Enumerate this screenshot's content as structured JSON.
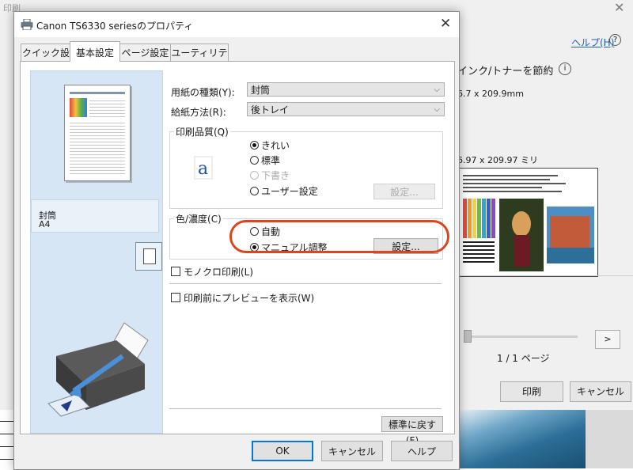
{
  "background_window": {
    "title": "印刷",
    "help_link": "ヘルプ(H)",
    "save_ink_toner": "インク/トナーを節約",
    "paper_size_mm": "6.7 x 209.9mm",
    "paper_size_mm2": "6.97 x 209.97 ミリ",
    "page_indicator": "1 / 1 ページ",
    "next_button": ">",
    "print_button": "印刷",
    "cancel_button": "キャンセル"
  },
  "dialog": {
    "title": "Canon TS6330 seriesのプロパティ",
    "tabs": [
      {
        "label": "クイック設定"
      },
      {
        "label": "基本設定"
      },
      {
        "label": "ページ設定"
      },
      {
        "label": "ユーティリティ"
      }
    ],
    "preview": {
      "media_type": "封筒",
      "media_size": "A4"
    },
    "media_type_label": "用紙の種類(Y):",
    "media_type_value": "封筒",
    "paper_source_label": "給紙方法(R):",
    "paper_source_value": "後トレイ",
    "print_quality": {
      "title": "印刷品質(Q)",
      "icon_glyph": "a",
      "options": [
        {
          "label": "きれい",
          "checked": true,
          "disabled": false
        },
        {
          "label": "標準",
          "checked": false,
          "disabled": false
        },
        {
          "label": "下書き",
          "checked": false,
          "disabled": true
        },
        {
          "label": "ユーザー設定",
          "checked": false,
          "disabled": false
        }
      ],
      "settings_button": "設定..."
    },
    "color_intensity": {
      "title": "色/濃度(C)",
      "options": [
        {
          "label": "自動",
          "checked": false
        },
        {
          "label": "マニュアル調整",
          "checked": true
        }
      ],
      "settings_button": "設定..."
    },
    "grayscale_checkbox": "モノクロ印刷(L)",
    "preview_checkbox": "印刷前にプレビューを表示(W)",
    "defaults_button": "標準に戻す(F)",
    "ok_button": "OK",
    "cancel_button": "キャンセル",
    "help_button": "ヘルプ",
    "close_glyph": "✕"
  },
  "colors": {
    "highlight": "#d9461f",
    "preview_bg": "#d6e6f4",
    "link": "#1a5fb4"
  }
}
